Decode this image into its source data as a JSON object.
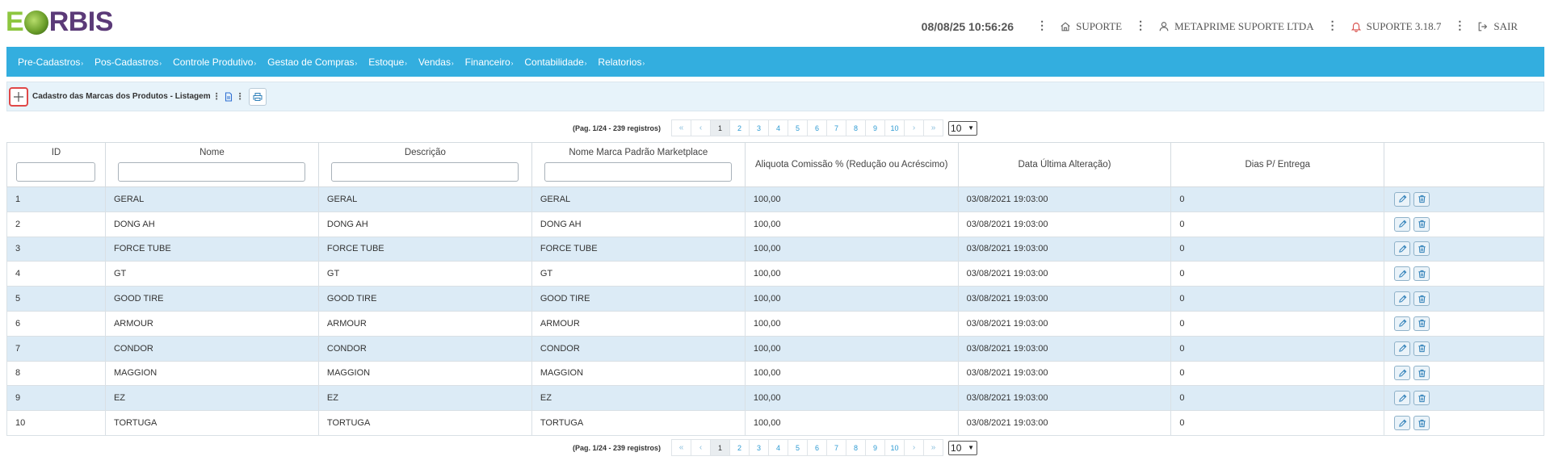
{
  "brand": {
    "logo_e": "E",
    "logo_rest": "RBIS"
  },
  "header": {
    "datetime": "08/08/25 10:56:26",
    "home_label": "SUPORTE",
    "user_label": "METAPRIME SUPORTE LTDA",
    "alert_label": "SUPORTE 3.18.7",
    "logout_label": "SAIR",
    "dots": "⋮"
  },
  "nav": {
    "items": [
      {
        "label": "Pre-Cadastros"
      },
      {
        "label": "Pos-Cadastros"
      },
      {
        "label": "Controle Produtivo"
      },
      {
        "label": "Gestao de Compras"
      },
      {
        "label": "Estoque"
      },
      {
        "label": "Vendas"
      },
      {
        "label": "Financeiro"
      },
      {
        "label": "Contabilidade"
      },
      {
        "label": "Relatorios"
      }
    ]
  },
  "toolbar": {
    "add_symbol": "+",
    "title": "Cadastro das Marcas dos Produtos - Listagem",
    "sep": "⋮"
  },
  "pagination": {
    "info": "(Pag. 1/24 - 239 registros)",
    "first": "«",
    "prev": "‹",
    "next": "›",
    "last": "»",
    "pages": [
      "1",
      "2",
      "3",
      "4",
      "5",
      "6",
      "7",
      "8",
      "9",
      "10"
    ],
    "current": "1",
    "page_size": "10"
  },
  "table": {
    "columns": [
      {
        "label": "ID",
        "filter": true
      },
      {
        "label": "Nome",
        "filter": true
      },
      {
        "label": "Descrição",
        "filter": true
      },
      {
        "label": "Nome Marca Padrão Marketplace",
        "filter": true
      },
      {
        "label": "Aliquota Comissão % (Redução ou Acréscimo)",
        "filter": false
      },
      {
        "label": "Data Última Alteração)",
        "filter": false
      },
      {
        "label": "Dias P/ Entrega",
        "filter": false
      },
      {
        "label": "",
        "filter": false
      }
    ],
    "rows": [
      [
        "1",
        "GERAL",
        "GERAL",
        "GERAL",
        "100,00",
        "03/08/2021 19:03:00",
        "0"
      ],
      [
        "2",
        "DONG AH",
        "DONG AH",
        "DONG AH",
        "100,00",
        "03/08/2021 19:03:00",
        "0"
      ],
      [
        "3",
        "FORCE TUBE",
        "FORCE TUBE",
        "FORCE TUBE",
        "100,00",
        "03/08/2021 19:03:00",
        "0"
      ],
      [
        "4",
        "GT",
        "GT",
        "GT",
        "100,00",
        "03/08/2021 19:03:00",
        "0"
      ],
      [
        "5",
        "GOOD TIRE",
        "GOOD TIRE",
        "GOOD TIRE",
        "100,00",
        "03/08/2021 19:03:00",
        "0"
      ],
      [
        "6",
        "ARMOUR",
        "ARMOUR",
        "ARMOUR",
        "100,00",
        "03/08/2021 19:03:00",
        "0"
      ],
      [
        "7",
        "CONDOR",
        "CONDOR",
        "CONDOR",
        "100,00",
        "03/08/2021 19:03:00",
        "0"
      ],
      [
        "8",
        "MAGGION",
        "MAGGION",
        "MAGGION",
        "100,00",
        "03/08/2021 19:03:00",
        "0"
      ],
      [
        "9",
        "EZ",
        "EZ",
        "EZ",
        "100,00",
        "03/08/2021 19:03:00",
        "0"
      ],
      [
        "10",
        "TORTUGA",
        "TORTUGA",
        "TORTUGA",
        "100,00",
        "03/08/2021 19:03:00",
        "0"
      ]
    ]
  },
  "icons": {
    "add": "plus-icon",
    "edit": "pencil-icon",
    "delete": "trash-icon",
    "print": "printer-icon",
    "export": "document-icon",
    "home": "home-icon",
    "user": "user-icon",
    "alert": "bell-icon",
    "logout": "logout-icon"
  },
  "colors": {
    "navbar": "#33aedf",
    "row_alt": "#dcebf6",
    "add_border": "#e04848",
    "logo_green": "#8dc63f",
    "logo_purple": "#5b3a78"
  }
}
